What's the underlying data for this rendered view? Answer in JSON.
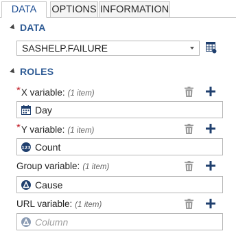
{
  "tabs": [
    {
      "label": "DATA"
    },
    {
      "label": "OPTIONS"
    },
    {
      "label": "INFORMATION"
    }
  ],
  "data_section": {
    "title": "DATA",
    "dataset": "SASHELP.FAILURE"
  },
  "roles_section": {
    "title": "ROLES",
    "roles": [
      {
        "label": "X variable:",
        "count": "(1 item)",
        "required": "*",
        "value": "Day",
        "icon": "calendar-icon"
      },
      {
        "label": "Y variable:",
        "count": "(1 item)",
        "required": "*",
        "value": "Count",
        "icon": "numeric-icon"
      },
      {
        "label": "Group variable:",
        "count": "(1 item)",
        "required": "",
        "value": "Cause",
        "icon": "category-icon"
      },
      {
        "label": "URL variable:",
        "count": "(1 item)",
        "required": "",
        "placeholder": "Column",
        "icon": "category-icon"
      }
    ]
  },
  "colors": {
    "accent": "#2d5a94",
    "required": "#c2202a",
    "icon_dark": "#1f3f6e"
  }
}
